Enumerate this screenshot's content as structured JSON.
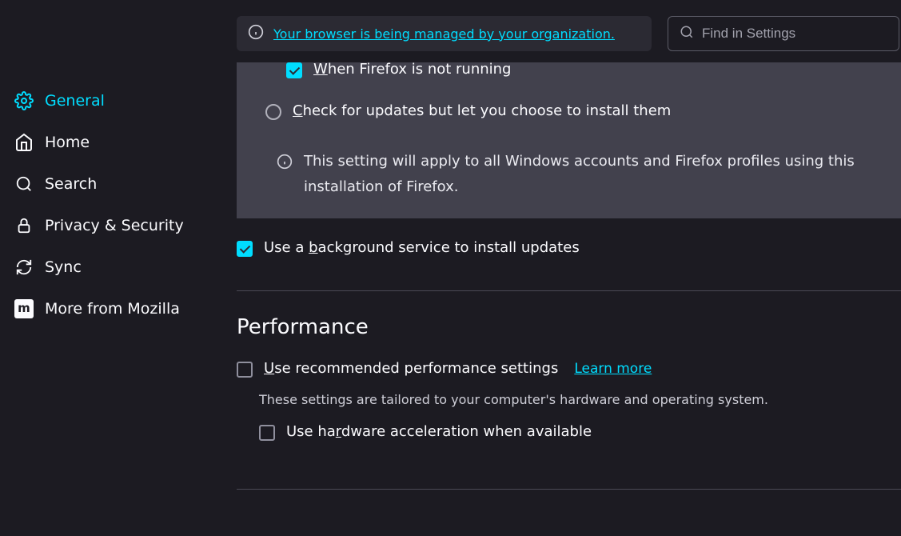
{
  "banner": {
    "text": "Your browser is being managed by your organization."
  },
  "search": {
    "placeholder": "Find in Settings"
  },
  "sidebar": {
    "items": [
      {
        "label": "General"
      },
      {
        "label": "Home"
      },
      {
        "label": "Search"
      },
      {
        "label": "Privacy & Security"
      },
      {
        "label": "Sync"
      },
      {
        "label": "More from Mozilla"
      }
    ]
  },
  "updates": {
    "when_not_running_prefix": "W",
    "when_not_running_rest": "hen Firefox is not running",
    "check_updates_prefix": "C",
    "check_updates_rest": "heck for updates but let you choose to install them",
    "info": "This setting will apply to all Windows accounts and Firefox profiles using this installation of Firefox.",
    "bg_service_pre": "Use a ",
    "bg_service_u": "b",
    "bg_service_post": "ackground service to install updates"
  },
  "performance": {
    "header": "Performance",
    "recommended_prefix": "U",
    "recommended_rest": "se recommended performance settings",
    "learn_more": "Learn more",
    "subtext": "These settings are tailored to your computer's hardware and operating system.",
    "hw_pre": "Use ha",
    "hw_u": "r",
    "hw_post": "dware acceleration when available"
  }
}
